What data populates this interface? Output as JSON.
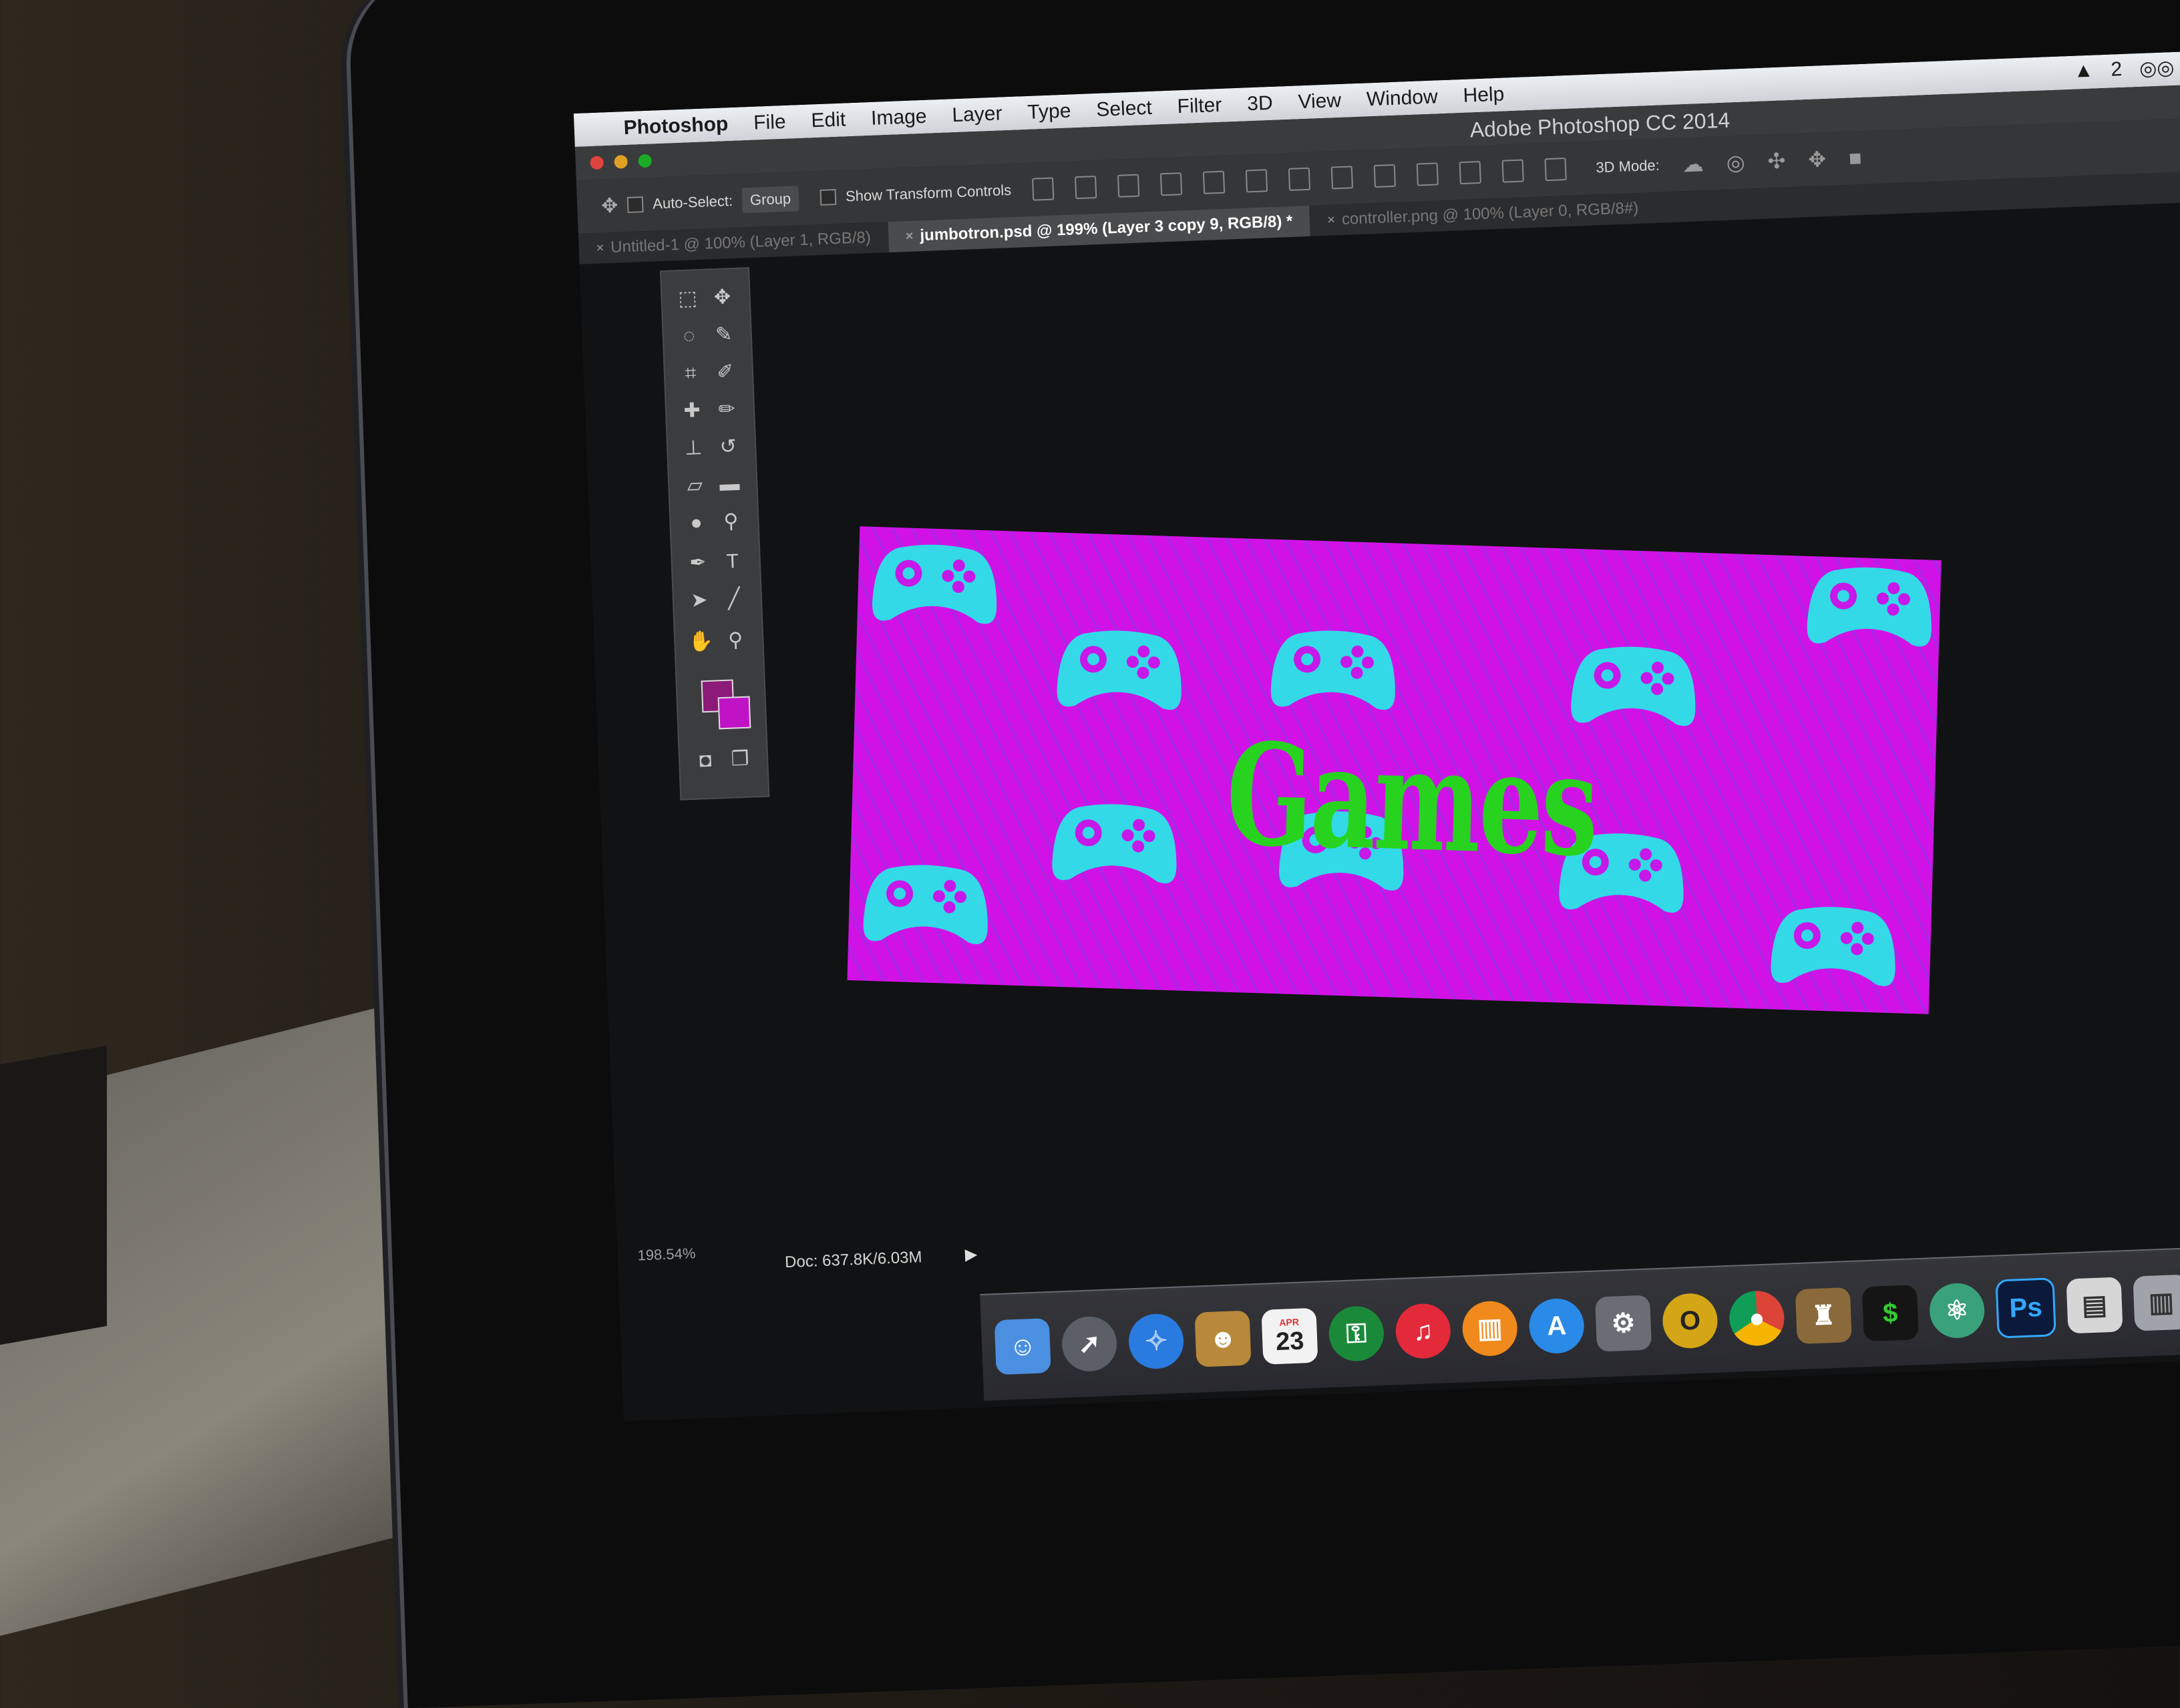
{
  "menubar": {
    "app_name": "Photoshop",
    "items": [
      "File",
      "Edit",
      "Image",
      "Layer",
      "Type",
      "Select",
      "Filter",
      "3D",
      "View",
      "Window",
      "Help"
    ],
    "status_count": "2"
  },
  "window": {
    "title": "Adobe Photoshop CC 2014"
  },
  "options_bar": {
    "auto_select_label": "Auto-Select:",
    "auto_select_value": "Group",
    "transform_controls_label": "Show Transform Controls",
    "mode_label": "3D Mode:"
  },
  "tabs": [
    {
      "label": "Untitled-1 @ 100% (Layer 1, RGB/8)",
      "active": false
    },
    {
      "label": "jumbotron.psd @ 199% (Layer 3 copy 9, RGB/8) *",
      "active": true
    },
    {
      "label": "controller.png @ 100% (Layer 0, RGB/8#)",
      "active": false
    }
  ],
  "canvas": {
    "text": "Games",
    "bg_color": "#d112e6",
    "text_color": "#27d31f",
    "icon_color": "#33d9e6"
  },
  "swatches": {
    "foreground": "#8b1a78",
    "background": "#c013c6"
  },
  "status": {
    "zoom": "198.54%",
    "doc_info": "Doc: 637.8K/6.03M"
  },
  "dock": {
    "calendar_month": "APR",
    "calendar_day": "23",
    "photoshop_label": "Ps"
  }
}
